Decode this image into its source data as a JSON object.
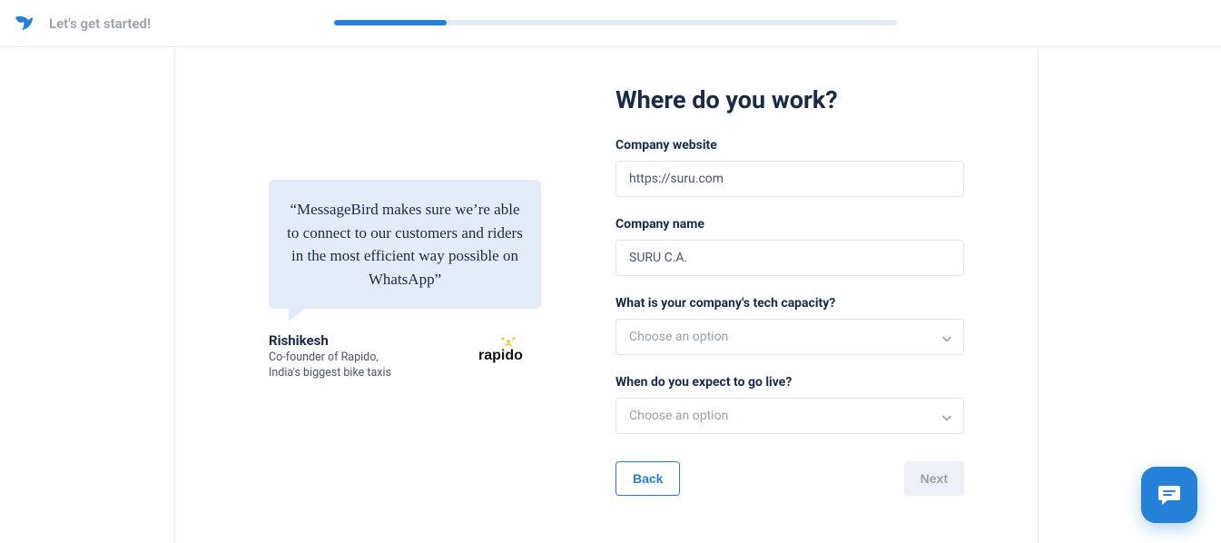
{
  "header": {
    "tagline": "Let's get started!"
  },
  "testimonial": {
    "quote": "“MessageBird makes sure we’re able to connect to our customers and riders in the most efficient way possible on WhatsApp”",
    "author_name": "Rishikesh",
    "author_role_line1": "Co-founder of Rapido,",
    "author_role_line2": "India's biggest bike taxis",
    "brand": "rapido"
  },
  "form": {
    "heading": "Where do you work?",
    "website_label": "Company website",
    "website_value": "https://suru.com",
    "name_label": "Company name",
    "name_value": "SURU C.A.",
    "tech_label": "What is your company's tech capacity?",
    "tech_placeholder": "Choose an option",
    "live_label": "When do you expect to go live?",
    "live_placeholder": "Choose an option",
    "back_label": "Back",
    "next_label": "Next"
  }
}
